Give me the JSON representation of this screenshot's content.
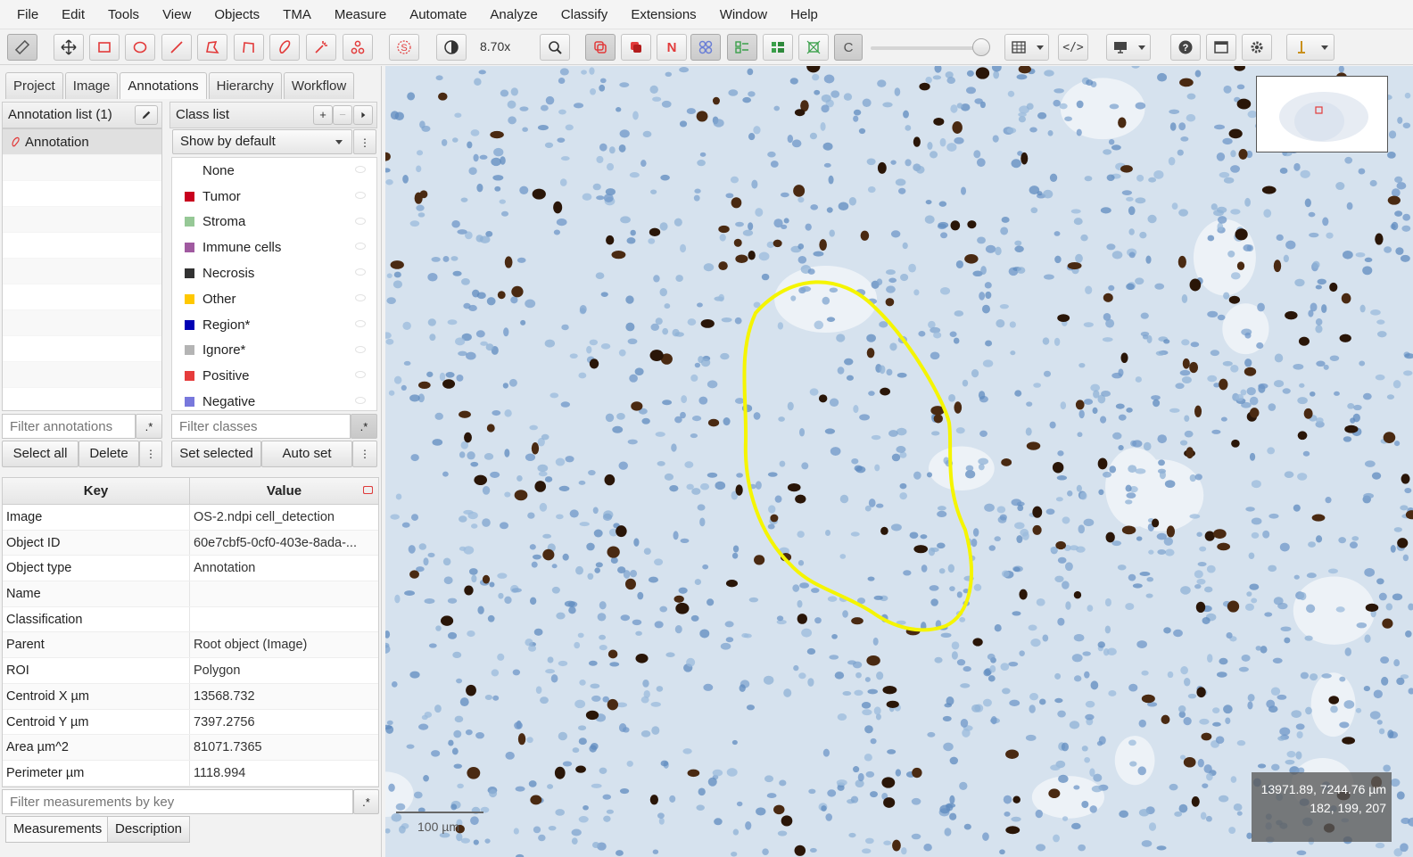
{
  "menu": [
    "File",
    "Edit",
    "Tools",
    "View",
    "Objects",
    "TMA",
    "Measure",
    "Automate",
    "Analyze",
    "Classify",
    "Extensions",
    "Window",
    "Help"
  ],
  "toolbar": {
    "zoom": "8.70x",
    "n_label": "N",
    "c_label": "C",
    "code_label": "</>"
  },
  "tabs": [
    "Project",
    "Image",
    "Annotations",
    "Hierarchy",
    "Workflow"
  ],
  "annotation_list": {
    "title": "Annotation list (1)",
    "items": [
      "Annotation"
    ],
    "filter_placeholder": "Filter annotations",
    "regex_label": ".*",
    "select_all": "Select all",
    "delete": "Delete"
  },
  "class_list": {
    "title": "Class list",
    "add_label": "+",
    "remove_label": "−",
    "show_mode": "Show by default",
    "classes": [
      {
        "name": "None",
        "color": ""
      },
      {
        "name": "Tumor",
        "color": "#c8001e"
      },
      {
        "name": "Stroma",
        "color": "#96c896"
      },
      {
        "name": "Immune cells",
        "color": "#a05aa0"
      },
      {
        "name": "Necrosis",
        "color": "#323232"
      },
      {
        "name": "Other",
        "color": "#ffc800"
      },
      {
        "name": "Region*",
        "color": "#0000b4"
      },
      {
        "name": "Ignore*",
        "color": "#b4b4b4"
      },
      {
        "name": "Positive",
        "color": "#e63c3c"
      },
      {
        "name": "Negative",
        "color": "#7878dc"
      }
    ],
    "filter_placeholder": "Filter classes",
    "regex_label": ".*",
    "set_selected": "Set selected",
    "auto_set": "Auto set"
  },
  "measurements": {
    "headers": {
      "key": "Key",
      "value": "Value"
    },
    "rows": [
      {
        "key": "Image",
        "value": "OS-2.ndpi cell_detection"
      },
      {
        "key": "Object ID",
        "value": "60e7cbf5-0cf0-403e-8ada-..."
      },
      {
        "key": "Object type",
        "value": "Annotation"
      },
      {
        "key": "Name",
        "value": ""
      },
      {
        "key": "Classification",
        "value": ""
      },
      {
        "key": "Parent",
        "value": "Root object (Image)"
      },
      {
        "key": "ROI",
        "value": "Polygon"
      },
      {
        "key": "Centroid X µm",
        "value": "13568.732"
      },
      {
        "key": "Centroid Y µm",
        "value": "7397.2756"
      },
      {
        "key": "Area µm^2",
        "value": "81071.7365"
      },
      {
        "key": "Perimeter µm",
        "value": "1118.994"
      }
    ],
    "filter_placeholder": "Filter measurements by key",
    "regex_label": ".*"
  },
  "bottom_tabs": [
    "Measurements",
    "Description"
  ],
  "viewer": {
    "coords_line1": "13971.89, 7244.76 µm",
    "coords_line2": "182, 199, 207",
    "scale_label": "100 µm",
    "annotation_color": "#f5f500"
  }
}
